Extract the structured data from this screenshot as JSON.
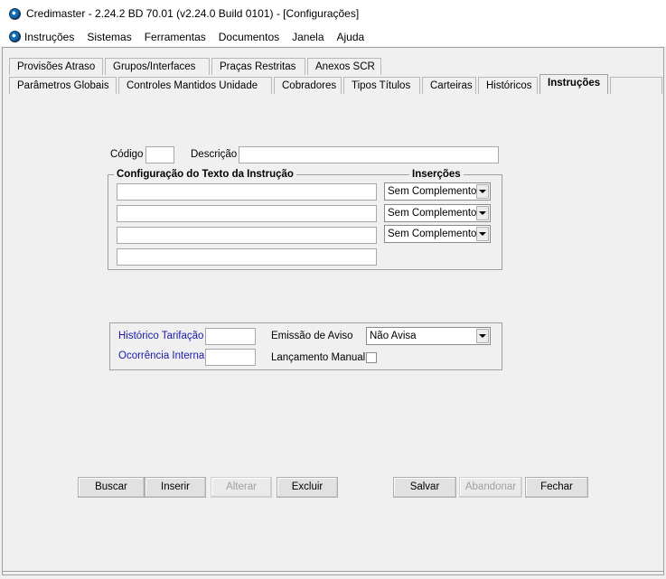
{
  "window": {
    "title": "Credimaster - 2.24.2 BD 70.01 (v2.24.0 Build 0101) - [Configurações]"
  },
  "menu": {
    "items": [
      "Instruções",
      "Sistemas",
      "Ferramentas",
      "Documentos",
      "Janela",
      "Ajuda"
    ]
  },
  "tabs": {
    "row1": [
      "Provisões Atraso",
      "Grupos/Interfaces",
      "Praças Restritas",
      "Anexos SCR"
    ],
    "row2": [
      "Parâmetros Globais",
      "Controles Mantidos Unidade",
      "Cobradores",
      "Tipos Títulos",
      "Carteiras",
      "Históricos",
      "Instruções"
    ],
    "active": "Instruções"
  },
  "form": {
    "codigo_label": "Código",
    "codigo_value": "",
    "descricao_label": "Descrição",
    "descricao_value": "",
    "config_group_title": "Configuração do Texto da Instrução",
    "insercoes_title": "Inserções",
    "text_lines": [
      "",
      "",
      "",
      ""
    ],
    "insercoes": [
      "Sem Complemento",
      "Sem Complemento",
      "Sem Complemento"
    ],
    "historico_tarifacao_label": "Histórico Tarifação",
    "historico_tarifacao_value": "",
    "ocorrencia_interna_label": "Ocorrência Interna",
    "ocorrencia_interna_value": "",
    "emissao_aviso_label": "Emissão de Aviso",
    "emissao_aviso_value": "Não Avisa",
    "lancamento_manual_label": "Lançamento Manual",
    "lancamento_manual_checked": false
  },
  "buttons": {
    "buscar": "Buscar",
    "inserir": "Inserir",
    "alterar": "Alterar",
    "excluir": "Excluir",
    "salvar": "Salvar",
    "abandonar": "Abandonar",
    "fechar": "Fechar"
  }
}
